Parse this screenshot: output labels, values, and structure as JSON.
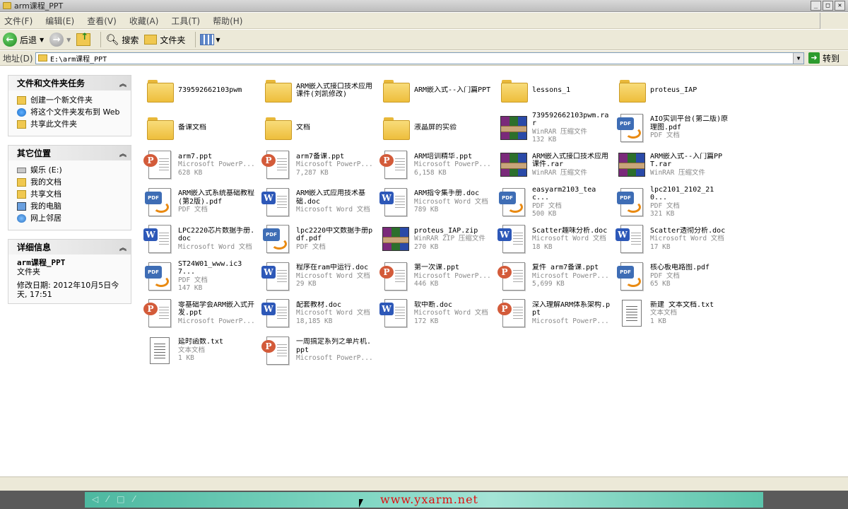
{
  "window": {
    "title": "arm课程_PPT",
    "btn_min": "_",
    "btn_max": "□",
    "btn_close": "✕"
  },
  "menu": [
    "文件(F)",
    "编辑(E)",
    "查看(V)",
    "收藏(A)",
    "工具(T)",
    "帮助(H)"
  ],
  "toolbar": {
    "back": "后退",
    "search": "搜索",
    "folders": "文件夹"
  },
  "address": {
    "label": "地址(D)",
    "value": "E:\\arm课程_PPT",
    "go": "转到"
  },
  "tasks": {
    "title": "文件和文件夹任务",
    "items": [
      "创建一个新文件夹",
      "将这个文件夹发布到 Web",
      "共享此文件夹"
    ]
  },
  "places": {
    "title": "其它位置",
    "items": [
      "娱乐 (E:)",
      "我的文档",
      "共享文档",
      "我的电脑",
      "网上邻居"
    ]
  },
  "details": {
    "title": "详细信息",
    "name": "arm课程_PPT",
    "type": "文件夹",
    "modified": "修改日期: 2012年10月5日今天, 17:51"
  },
  "files": [
    {
      "icon": "folder",
      "name": "739592662103pwm",
      "type": "",
      "size": ""
    },
    {
      "icon": "folder",
      "name": "ARM嵌入式接口技术应用课件(刘凯修改)",
      "type": "",
      "size": ""
    },
    {
      "icon": "folder",
      "name": "ARM嵌入式--入门篇PPT",
      "type": "",
      "size": ""
    },
    {
      "icon": "folder",
      "name": "lessons_1",
      "type": "",
      "size": ""
    },
    {
      "icon": "folder",
      "name": "proteus_IAP",
      "type": "",
      "size": ""
    },
    {
      "icon": "folder",
      "name": "备课文档",
      "type": "",
      "size": ""
    },
    {
      "icon": "folder",
      "name": "文档",
      "type": "",
      "size": ""
    },
    {
      "icon": "folder",
      "name": "液晶屏的实验",
      "type": "",
      "size": ""
    },
    {
      "icon": "rar",
      "name": "739592662103pwm.rar",
      "type": "WinRAR 压缩文件",
      "size": "132 KB"
    },
    {
      "icon": "pdf",
      "name": "AIO实训平台(第二版)原理图.pdf",
      "type": "PDF 文档",
      "size": ""
    },
    {
      "icon": "ppt",
      "name": "arm7.ppt",
      "type": "Microsoft PowerP...",
      "size": "628 KB"
    },
    {
      "icon": "ppt",
      "name": "arm7备课.ppt",
      "type": "Microsoft PowerP...",
      "size": "7,287 KB"
    },
    {
      "icon": "ppt",
      "name": "ARM培训精华.ppt",
      "type": "Microsoft PowerP...",
      "size": "6,158 KB"
    },
    {
      "icon": "rar",
      "name": "ARM嵌入式接口技术应用课件.rar",
      "type": "WinRAR 压缩文件",
      "size": ""
    },
    {
      "icon": "rar",
      "name": "ARM嵌入式--入门篇PPT.rar",
      "type": "WinRAR 压缩文件",
      "size": ""
    },
    {
      "icon": "pdf",
      "name": "ARM嵌入式系统基础教程(第2版).pdf",
      "type": "PDF 文档",
      "size": ""
    },
    {
      "icon": "doc",
      "name": "ARM嵌入式应用技术基础.doc",
      "type": "Microsoft Word 文档",
      "size": ""
    },
    {
      "icon": "doc",
      "name": "ARM指令集手册.doc",
      "type": "Microsoft Word 文档",
      "size": "789 KB"
    },
    {
      "icon": "pdf",
      "name": "easyarm2103_teac...",
      "type": "PDF 文档",
      "size": "500 KB"
    },
    {
      "icon": "pdf",
      "name": "lpc2101_2102_210...",
      "type": "PDF 文档",
      "size": "321 KB"
    },
    {
      "icon": "doc",
      "name": "LPC2220芯片数据手册.doc",
      "type": "Microsoft Word 文档",
      "size": ""
    },
    {
      "icon": "pdf",
      "name": "lpc2220中文数据手册pdf.pdf",
      "type": "PDF 文档",
      "size": ""
    },
    {
      "icon": "rar",
      "name": "proteus_IAP.zip",
      "type": "WinRAR ZIP 压缩文件",
      "size": "270 KB"
    },
    {
      "icon": "doc",
      "name": "Scatter趣味分析.doc",
      "type": "Microsoft Word 文档",
      "size": "18 KB"
    },
    {
      "icon": "doc",
      "name": "Scatter透彻分析.doc",
      "type": "Microsoft Word 文档",
      "size": "17 KB"
    },
    {
      "icon": "pdf",
      "name": "ST24W01_www.ic37...",
      "type": "PDF 文档",
      "size": "147 KB"
    },
    {
      "icon": "doc",
      "name": "程序在ram中运行.doc",
      "type": "Microsoft Word 文档",
      "size": "29 KB"
    },
    {
      "icon": "ppt",
      "name": "第一次课.ppt",
      "type": "Microsoft PowerP...",
      "size": "446 KB"
    },
    {
      "icon": "ppt",
      "name": "复件 arm7备课.ppt",
      "type": "Microsoft PowerP...",
      "size": "5,699 KB"
    },
    {
      "icon": "pdf",
      "name": "核心板电路图.pdf",
      "type": "PDF 文档",
      "size": "65 KB"
    },
    {
      "icon": "ppt",
      "name": "零基础学会ARM嵌入式开发.ppt",
      "type": "Microsoft PowerP...",
      "size": ""
    },
    {
      "icon": "doc",
      "name": "配套教材.doc",
      "type": "Microsoft Word 文档",
      "size": "18,185 KB"
    },
    {
      "icon": "doc",
      "name": "软中断.doc",
      "type": "Microsoft Word 文档",
      "size": "172 KB"
    },
    {
      "icon": "ppt",
      "name": "深入理解ARM体系架构.ppt",
      "type": "Microsoft PowerP...",
      "size": ""
    },
    {
      "icon": "txt",
      "name": "新建 文本文档.txt",
      "type": "文本文档",
      "size": "1 KB"
    },
    {
      "icon": "txt",
      "name": "延时函数.txt",
      "type": "文本文档",
      "size": "1 KB"
    },
    {
      "icon": "ppt",
      "name": "一周搞定系列之单片机.ppt",
      "type": "Microsoft PowerP...",
      "size": ""
    }
  ],
  "watermark": "www.yxarm.net"
}
